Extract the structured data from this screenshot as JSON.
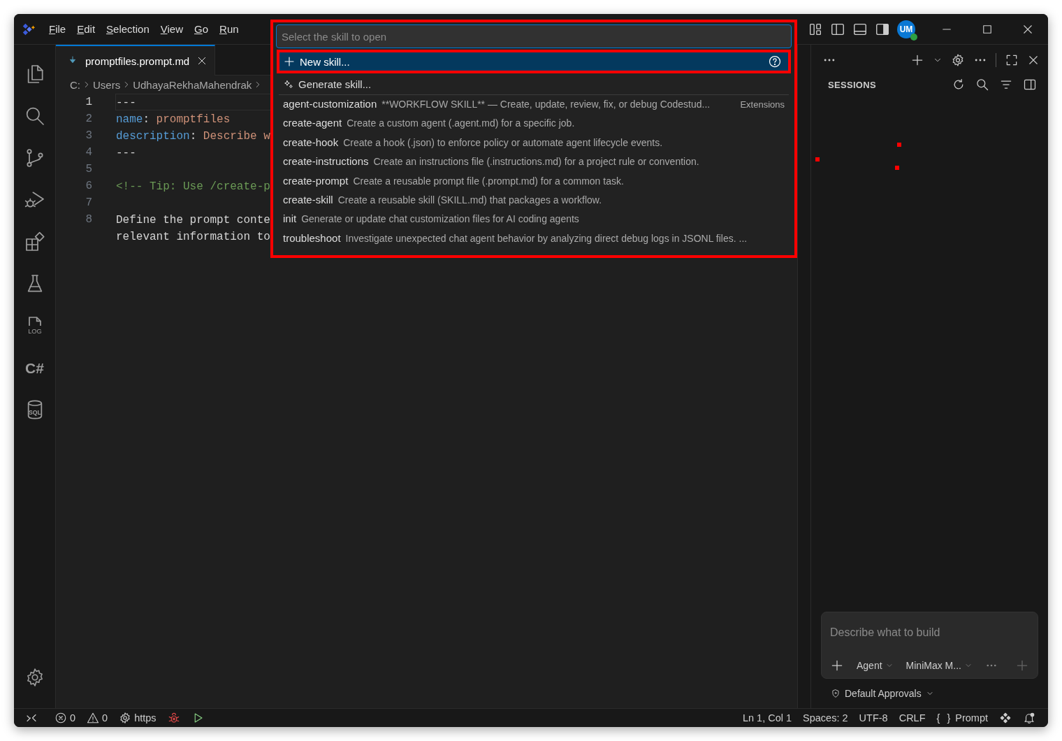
{
  "title_bar": {
    "menu": [
      "File",
      "Edit",
      "Selection",
      "View",
      "Go",
      "Run"
    ],
    "avatar": "UM"
  },
  "activity_bar": {
    "items": [
      {
        "kind": "files"
      },
      {
        "kind": "search"
      },
      {
        "kind": "source-control"
      },
      {
        "kind": "debug"
      },
      {
        "kind": "extensions"
      },
      {
        "kind": "testing"
      },
      {
        "kind": "log",
        "text": "LOG"
      },
      {
        "kind": "csharp",
        "text": "C#"
      },
      {
        "kind": "sql",
        "text": "SQL"
      }
    ],
    "bottom": [
      {
        "kind": "settings"
      }
    ]
  },
  "editor": {
    "tabs": [
      {
        "label": "promptfiles.prompt.md",
        "selected": true
      }
    ],
    "breadcrumbs": [
      "C:",
      "Users",
      "UdhayaRekhaMahendrak"
    ],
    "lines": [
      {
        "number": "1",
        "current": true,
        "tokens": [
          {
            "kind": "plain",
            "text": "---"
          }
        ]
      },
      {
        "number": "2",
        "current": false,
        "tokens": [
          {
            "kind": "key",
            "text": "name"
          },
          {
            "kind": "plain",
            "text": ": "
          },
          {
            "kind": "value",
            "text": "promptfiles"
          }
        ]
      },
      {
        "number": "3",
        "current": false,
        "tokens": [
          {
            "kind": "key",
            "text": "description"
          },
          {
            "kind": "plain",
            "text": ": "
          },
          {
            "kind": "value",
            "text": "Describe w"
          }
        ]
      },
      {
        "number": "4",
        "current": false,
        "tokens": [
          {
            "kind": "plain",
            "text": "---"
          }
        ]
      },
      {
        "number": "5",
        "current": false
      },
      {
        "number": "6",
        "current": false,
        "tokens": [
          {
            "kind": "comment",
            "text": "<!-- Tip: Use /create-p"
          }
        ]
      },
      {
        "number": "7",
        "current": false
      },
      {
        "number": "8",
        "current": false,
        "tokens": [
          {
            "kind": "plain",
            "text": "Define the prompt conte"
          }
        ]
      },
      {
        "current": false,
        "tokens": [
          {
            "kind": "plain",
            "text": "relevant information to"
          }
        ]
      }
    ]
  },
  "quick_pick": {
    "placeholder": "Select the skill to open",
    "actions": [
      {
        "kind": "new",
        "label": "New skill...",
        "selected": true
      },
      {
        "kind": "generate",
        "label": "Generate skill...",
        "selected": false
      }
    ],
    "items": [
      {
        "name": "agent-customization",
        "description": "**WORKFLOW SKILL** — Create, update, review, fix, or debug Codestud...",
        "source": "Extensions"
      },
      {
        "name": "create-agent",
        "description": "Create a custom agent (.agent.md) for a specific job."
      },
      {
        "name": "create-hook",
        "description": "Create a hook (.json) to enforce policy or automate agent lifecycle events."
      },
      {
        "name": "create-instructions",
        "description": "Create an instructions file (.instructions.md) for a project rule or convention."
      },
      {
        "name": "create-prompt",
        "description": "Create a reusable prompt file (.prompt.md) for a common task."
      },
      {
        "name": "create-skill",
        "description": "Create a reusable skill (SKILL.md) that packages a workflow."
      },
      {
        "name": "init",
        "description": "Generate or update chat customization files for AI coding agents"
      },
      {
        "name": "troubleshoot",
        "description": "Investigate unexpected chat agent behavior by analyzing direct debug logs in JSONL files. ..."
      }
    ]
  },
  "sessions_panel": {
    "title": "SESSIONS",
    "chat": {
      "placeholder": "Describe what to build",
      "mode": "Agent",
      "model": "MiniMax M...",
      "approvals": "Default Approvals"
    }
  },
  "status_bar": {
    "left": [
      {
        "kind": "remote"
      },
      {
        "kind": "errors",
        "text": "0"
      },
      {
        "kind": "warnings",
        "text": "0"
      },
      {
        "kind": "gear",
        "text": "https"
      },
      {
        "kind": "bug"
      },
      {
        "kind": "run"
      }
    ],
    "right": [
      {
        "kind": "text",
        "text": "Ln 1, Col 1"
      },
      {
        "kind": "text",
        "text": "Spaces: 2"
      },
      {
        "kind": "text",
        "text": "UTF-8"
      },
      {
        "kind": "text",
        "text": "CRLF"
      },
      {
        "kind": "language",
        "icon_text": "{ }",
        "text": "Prompt"
      },
      {
        "kind": "copilot"
      },
      {
        "kind": "bell"
      }
    ]
  }
}
